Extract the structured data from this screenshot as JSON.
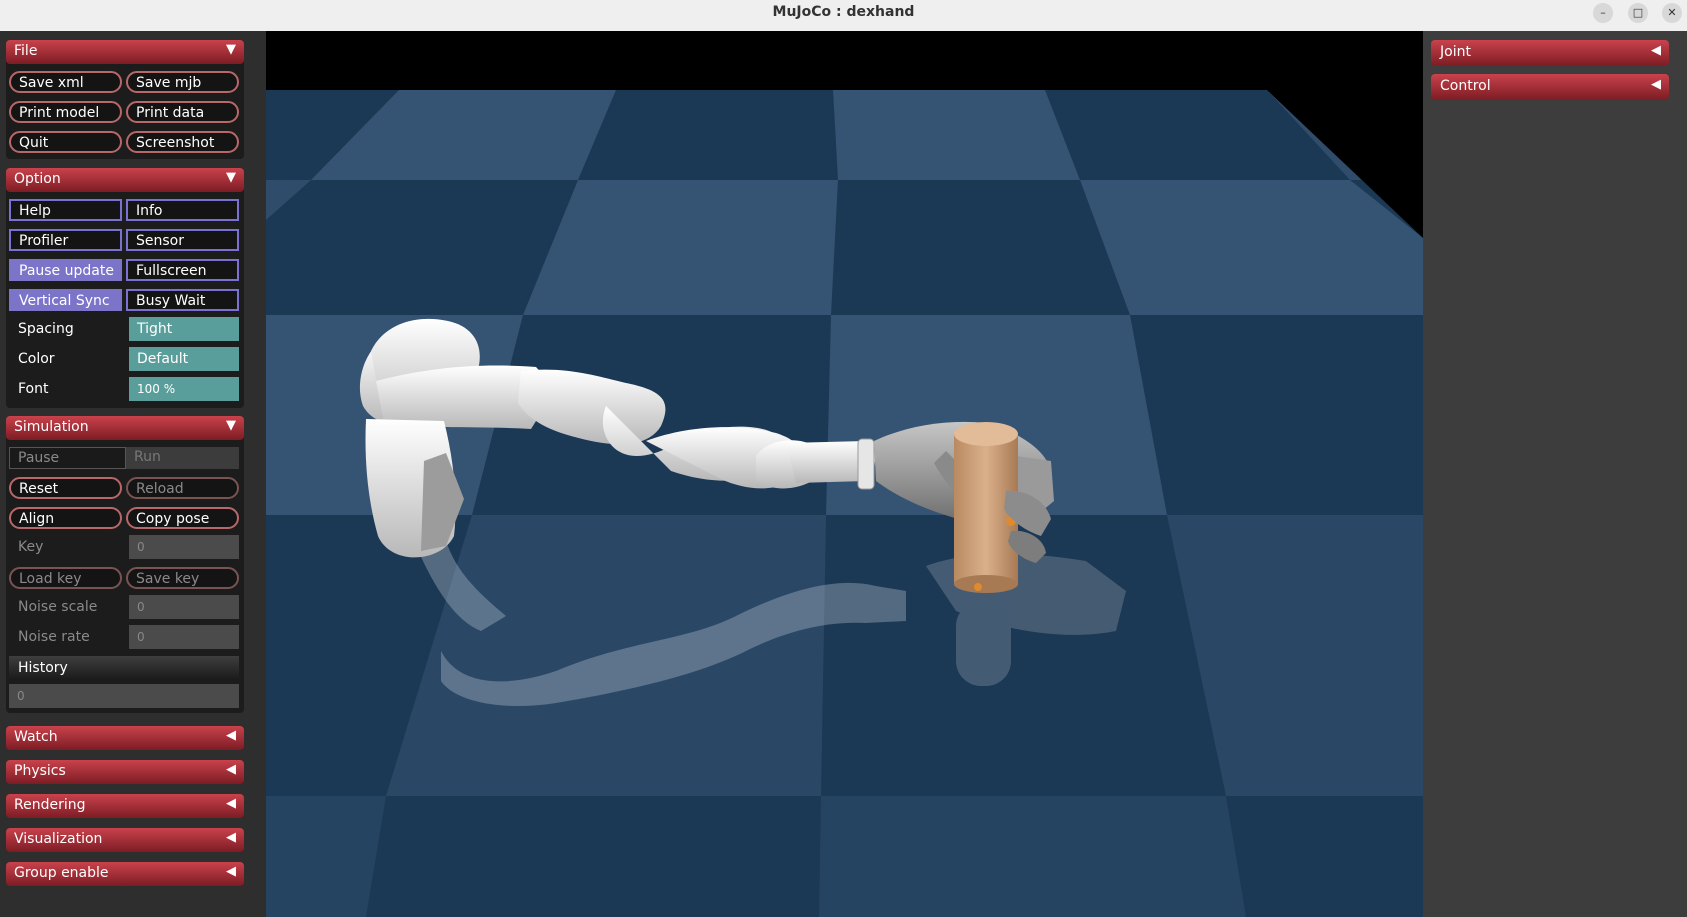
{
  "window": {
    "title": "MuJoCo : dexhand"
  },
  "left": {
    "file": {
      "title": "File",
      "save_xml": "Save xml",
      "save_mjb": "Save mjb",
      "print_model": "Print model",
      "print_data": "Print data",
      "quit": "Quit",
      "screenshot": "Screenshot"
    },
    "option": {
      "title": "Option",
      "help": "Help",
      "info": "Info",
      "profiler": "Profiler",
      "sensor": "Sensor",
      "pause_update": "Pause update",
      "fullscreen": "Fullscreen",
      "vertical_sync": "Vertical Sync",
      "busy_wait": "Busy Wait",
      "spacing_label": "Spacing",
      "spacing_value": "Tight",
      "color_label": "Color",
      "color_value": "Default",
      "font_label": "Font",
      "font_value": "100 %"
    },
    "simulation": {
      "title": "Simulation",
      "pause": "Pause",
      "run": "Run",
      "reset": "Reset",
      "reload": "Reload",
      "align": "Align",
      "copy_pose": "Copy pose",
      "key_label": "Key",
      "key_value": "0",
      "load_key": "Load key",
      "save_key": "Save key",
      "noise_scale_label": "Noise scale",
      "noise_scale_value": "0",
      "noise_rate_label": "Noise rate",
      "noise_rate_value": "0",
      "history_label": "History",
      "history_value": "0"
    },
    "collapsed": [
      "Watch",
      "Physics",
      "Rendering",
      "Visualization",
      "Group enable"
    ]
  },
  "right": {
    "sections": [
      "Joint",
      "Control"
    ]
  },
  "colors": {
    "header": "#b2343e",
    "check_on": "#7b74c9",
    "select": "#5a9e9b",
    "floor_light": "#355372",
    "floor_dark": "#193552"
  }
}
